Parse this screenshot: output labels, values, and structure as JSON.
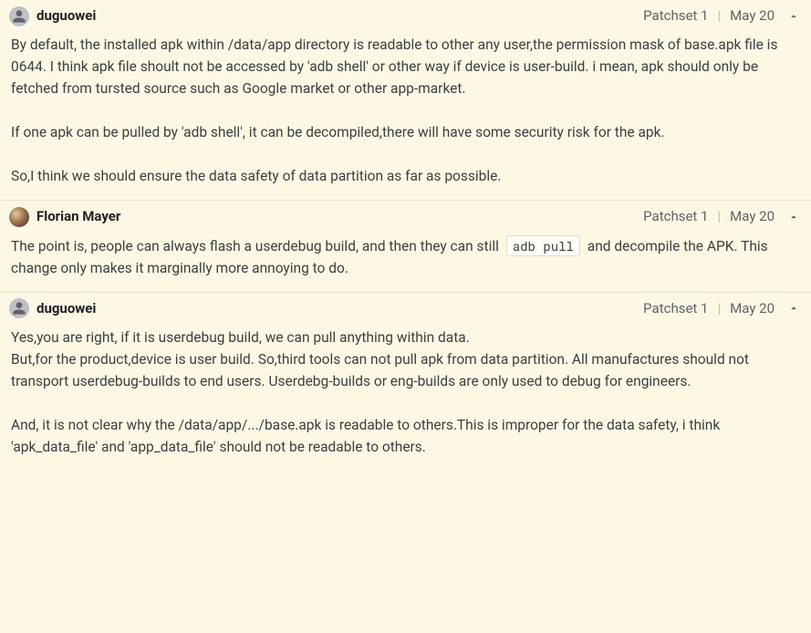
{
  "comments": [
    {
      "author": "duguowei",
      "avatarType": "generic",
      "patchset": "Patchset 1",
      "date": "May 20",
      "bodyLines": [
        "By default, the installed apk within /data/app directory is readable to other any user,the permission mask of base.apk file is 0644. I think apk file shoult not be accessed by 'adb shell' or other way if device is user-build. i mean, apk should only be fetched from tursted source such as Google market or other app-market.",
        "",
        "If one apk can be pulled by 'adb shell', it can be decompiled,there will have some security risk for the apk.",
        "",
        "So,I think we should ensure the data safety of data partition as far as possible."
      ]
    },
    {
      "author": "Florian Mayer",
      "avatarType": "photo",
      "patchset": "Patchset 1",
      "date": "May 20",
      "bodyPre": "The point is, people can always flash a userdebug build, and then they can still ",
      "bodyCode": "adb pull",
      "bodyPost": " and decompile the APK. This change only makes it marginally more annoying to do."
    },
    {
      "author": "duguowei",
      "avatarType": "generic",
      "patchset": "Patchset 1",
      "date": "May 20",
      "bodyLines": [
        "Yes,you are right, if it is userdebug build, we can pull anything within data.",
        "But,for the product,device is user build. So,third tools can not pull apk from data partition. All manufactures should not transport userdebug-builds to end users. Userdebg-builds or eng-builds are only used to debug for engineers.",
        "",
        "And, it is not clear why the /data/app/.../base.apk is readable to others.This is improper for the data safety, i think 'apk_data_file' and 'app_data_file' should not be readable to others."
      ]
    }
  ]
}
